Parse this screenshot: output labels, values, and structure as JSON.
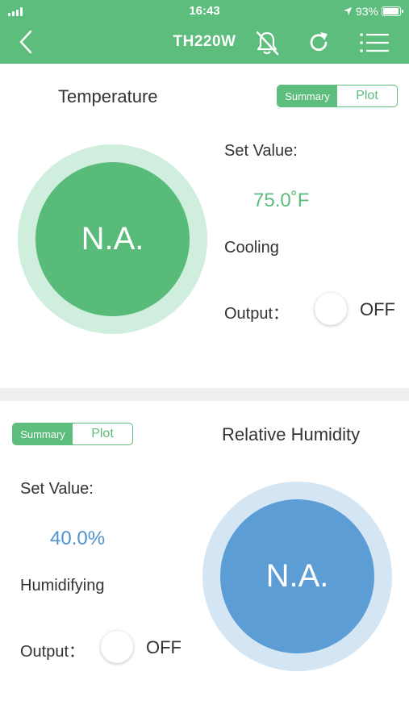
{
  "status_bar": {
    "time": "16:43",
    "battery": "93%",
    "battery_level": 0.93
  },
  "header": {
    "title": "TH220W",
    "icons": [
      "back-icon",
      "bell-off-icon",
      "refresh-icon",
      "menu-list-icon"
    ]
  },
  "temperature": {
    "title": "Temperature",
    "toggle": {
      "summary": "Summary",
      "plot": "Plot",
      "selected": "Summary"
    },
    "dial_value": "N.A.",
    "set_value_label": "Set Value:",
    "set_value": "75.0˚F",
    "mode": "Cooling",
    "output_label": "Output：",
    "output_state": "OFF",
    "colors": {
      "ring": "#cfeedd",
      "inner": "#58bb79",
      "value": "#5cbd7c"
    }
  },
  "humidity": {
    "title": "Relative Humidity",
    "toggle": {
      "summary": "Summary",
      "plot": "Plot",
      "selected": "Summary"
    },
    "dial_value": "N.A.",
    "set_value_label": "Set Value:",
    "set_value": "40.0%",
    "mode": "Humidifying",
    "output_label": "Output：",
    "output_state": "OFF",
    "colors": {
      "ring": "#d4e5f4",
      "inner": "#5d9dd5",
      "value": "#4f93cf"
    }
  },
  "colors": {
    "header": "#5cbd7c",
    "divider": "#efefef"
  }
}
